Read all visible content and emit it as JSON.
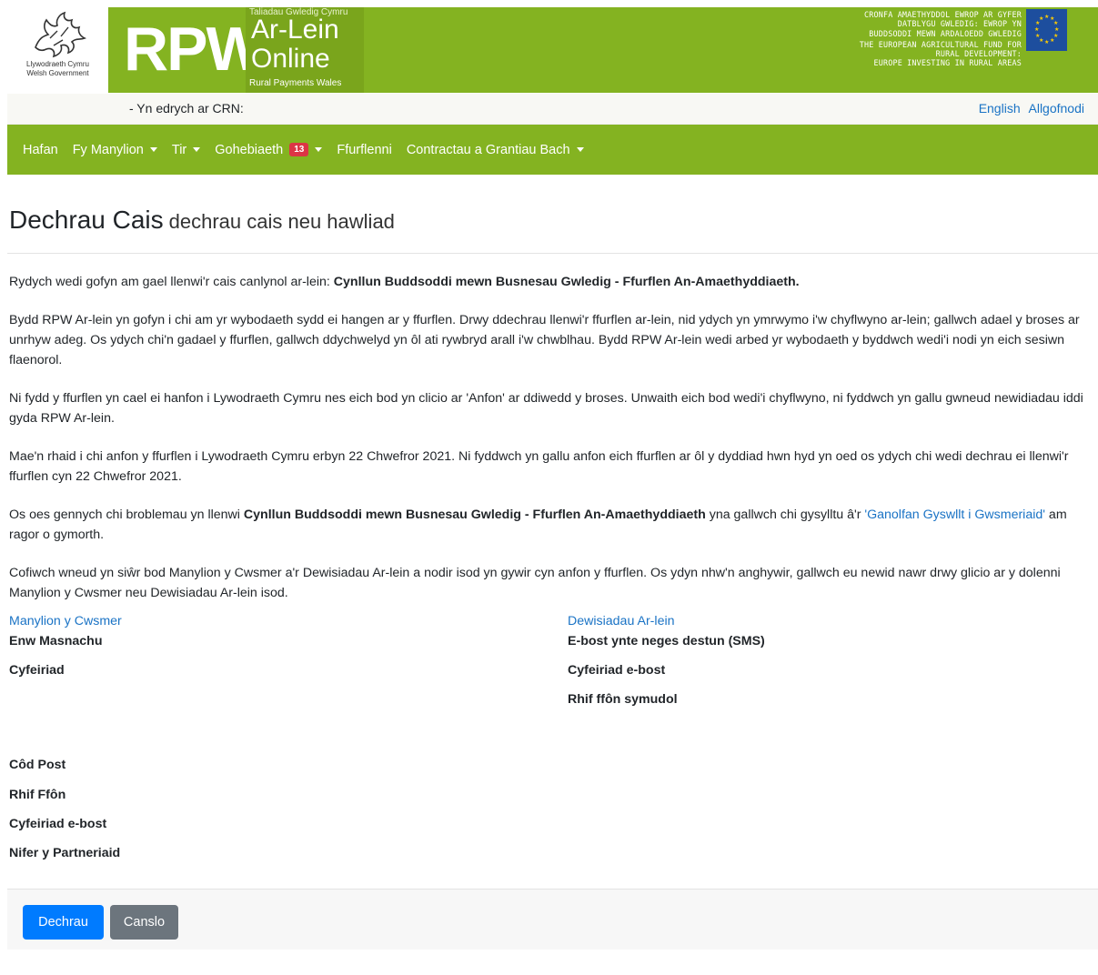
{
  "banner": {
    "wg_logo_line1": "Llywodraeth Cymru",
    "wg_logo_line2": "Welsh Government",
    "rpw": "RPW",
    "online_small_top": "Taliadau Gwledig Cymru",
    "online_big1": "Ar-Lein",
    "online_big2": "Online",
    "online_small_bottom": "Rural Payments Wales",
    "eu_text_lines": [
      "CRONFA AMAETHYDDOL EWROP AR GYFER",
      "DATBLYGU GWLEDIG: EWROP YN",
      "BUDDSODDI MEWN ARDALOEDD GWLEDIG",
      "THE EUROPEAN AGRICULTURAL FUND FOR",
      "RURAL DEVELOPMENT:",
      "EUROPE INVESTING IN RURAL AREAS"
    ]
  },
  "crn_bar": {
    "label": "- Yn edrych ar CRN:",
    "english": "English",
    "logout": "Allgofnodi"
  },
  "nav": {
    "home": "Hafan",
    "my_details": "Fy Manylion",
    "land": "Tir",
    "correspondence": "Gohebiaeth",
    "correspondence_count": "13",
    "forms": "Ffurflenni",
    "contracts": "Contractau a Grantiau Bach"
  },
  "page": {
    "title": "Dechrau Cais",
    "subtitle": "dechrau cais neu hawliad"
  },
  "paras": {
    "p1_text": "Rydych wedi gofyn am gael llenwi'r cais canlynol ar-lein: ",
    "p1_bold": "Cynllun Buddsoddi mewn Busnesau Gwledig - Ffurflen An-Amaethyddiaeth.",
    "p2": "Bydd RPW Ar-lein yn gofyn i chi am yr wybodaeth sydd ei hangen ar y ffurflen. Drwy ddechrau llenwi'r ffurflen ar-lein, nid ydych yn ymrwymo i'w chyflwyno ar-lein; gallwch adael y broses ar unrhyw adeg. Os ydych chi'n gadael y ffurflen, gallwch ddychwelyd yn ôl ati rywbryd arall i'w chwblhau. Bydd RPW Ar-lein wedi arbed yr wybodaeth y byddwch wedi'i nodi yn eich sesiwn flaenorol.",
    "p3": "Ni fydd y ffurflen yn cael ei hanfon i Lywodraeth Cymru nes eich bod yn clicio ar 'Anfon' ar ddiwedd y broses. Unwaith eich bod wedi'i chyflwyno, ni fyddwch yn gallu gwneud newidiadau iddi gyda RPW Ar-lein.",
    "p4": "Mae'n rhaid i chi anfon y ffurflen i Lywodraeth Cymru erbyn 22 Chwefror 2021. Ni fyddwch yn gallu anfon eich ffurflen ar ôl y dyddiad hwn hyd yn oed os ydych chi wedi dechrau ei llenwi'r ffurflen cyn 22 Chwefror 2021.",
    "p5_a": "Os oes gennych chi broblemau yn llenwi ",
    "p5_bold": "Cynllun Buddsoddi mewn Busnesau Gwledig - Ffurflen An-Amaethyddiaeth",
    "p5_b": " yna gallwch chi gysylltu â'r ",
    "p5_link": "'Ganolfan Gyswllt i Gwsmeriaid'",
    "p5_c": " am ragor o gymorth.",
    "p6": "Cofiwch wneud yn siŵr bod Manylion y Cwsmer a'r Dewisiadau Ar-lein a nodir isod yn gywir cyn anfon y ffurflen. Os ydyn nhw'n anghywir, gallwch eu newid nawr drwy glicio ar y dolenni Manylion y Cwsmer neu Dewisiadau Ar-lein isod."
  },
  "customer": {
    "link": "Manylion y Cwsmer",
    "trading_name": "Enw Masnachu",
    "address": "Cyfeiriad",
    "postcode": "Côd Post",
    "phone": "Rhif Ffôn",
    "email": "Cyfeiriad e-bost",
    "partners": "Nifer y Partneriaid"
  },
  "online_prefs": {
    "link": "Dewisiadau Ar-lein",
    "email_or_sms": "E-bost ynte neges destun (SMS)",
    "email": "Cyfeiriad e-bost",
    "mobile": "Rhif ffôn symudol"
  },
  "footer": {
    "start": "Dechrau",
    "cancel": "Canslo"
  }
}
